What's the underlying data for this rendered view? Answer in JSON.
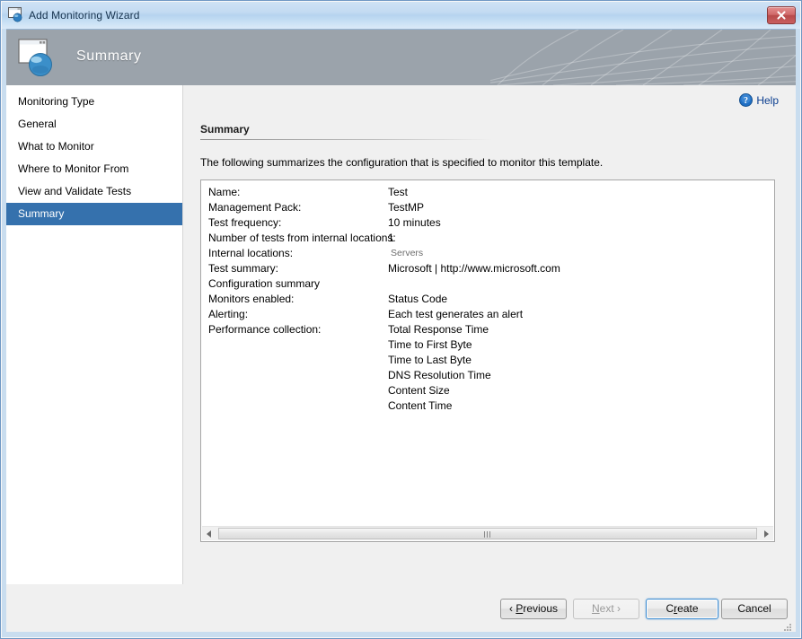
{
  "window": {
    "title": "Add Monitoring Wizard",
    "title_icon": "window-globe-icon",
    "close_label": "Close"
  },
  "banner": {
    "title": "Summary",
    "icon": "window-globe-icon",
    "background_color": "#9ba3ab"
  },
  "sidebar": {
    "items": [
      {
        "label": "Monitoring Type",
        "selected": false
      },
      {
        "label": "General",
        "selected": false
      },
      {
        "label": "What to Monitor",
        "selected": false
      },
      {
        "label": "Where to Monitor From",
        "selected": false
      },
      {
        "label": "View and Validate Tests",
        "selected": false
      },
      {
        "label": "Summary",
        "selected": true
      }
    ],
    "selected_color": "#3571ad"
  },
  "content": {
    "help_label": "Help",
    "help_icon": "help-circle-icon",
    "section_title": "Summary",
    "description": "The following summarizes the configuration that is specified to monitor this template.",
    "rows": [
      {
        "label": "Name:",
        "value": "Test",
        "muted": false
      },
      {
        "label": "Management Pack:",
        "value": "TestMP",
        "muted": false
      },
      {
        "label": "Test frequency:",
        "value": "10 minutes",
        "muted": false
      },
      {
        "label": "Number of tests from internal locations:",
        "value": "1",
        "muted": false
      },
      {
        "label": "Internal locations:",
        "value": "Servers",
        "muted": true
      },
      {
        "label": "Test summary:",
        "value": "Microsoft | http://www.microsoft.com",
        "muted": false
      },
      {
        "label": "Configuration summary",
        "value": "",
        "muted": false
      },
      {
        "label": "Monitors enabled:",
        "value": "Status Code",
        "muted": false
      },
      {
        "label": "Alerting:",
        "value": "Each test generates an alert",
        "muted": false
      },
      {
        "label": "Performance collection:",
        "value": "Total Response Time",
        "muted": false
      },
      {
        "label": "",
        "value": "Time to First Byte",
        "muted": false
      },
      {
        "label": "",
        "value": "Time to Last Byte",
        "muted": false
      },
      {
        "label": "",
        "value": "DNS Resolution Time",
        "muted": false
      },
      {
        "label": "",
        "value": "Content Size",
        "muted": false
      },
      {
        "label": "",
        "value": "Content Time",
        "muted": false
      }
    ],
    "scrollbar": {
      "left_arrow_icon": "triangle-left-icon",
      "right_arrow_icon": "triangle-right-icon",
      "grip_icon": "scrollbar-grip-icon"
    }
  },
  "footer": {
    "buttons": [
      {
        "name": "previous",
        "prefix": "‹ ",
        "accel": "P",
        "rest": "revious",
        "suffix": "",
        "disabled": false,
        "default": false
      },
      {
        "name": "next",
        "prefix": "",
        "accel": "N",
        "rest": "ext",
        "suffix": " ›",
        "disabled": true,
        "default": false
      },
      {
        "name": "create",
        "prefix": "C",
        "accel": "r",
        "rest": "eate",
        "suffix": "",
        "disabled": false,
        "default": true
      },
      {
        "name": "cancel",
        "prefix": "Cancel",
        "accel": "",
        "rest": "",
        "suffix": "",
        "disabled": false,
        "default": false
      }
    ],
    "resize_grip_icon": "resize-grip-icon"
  }
}
